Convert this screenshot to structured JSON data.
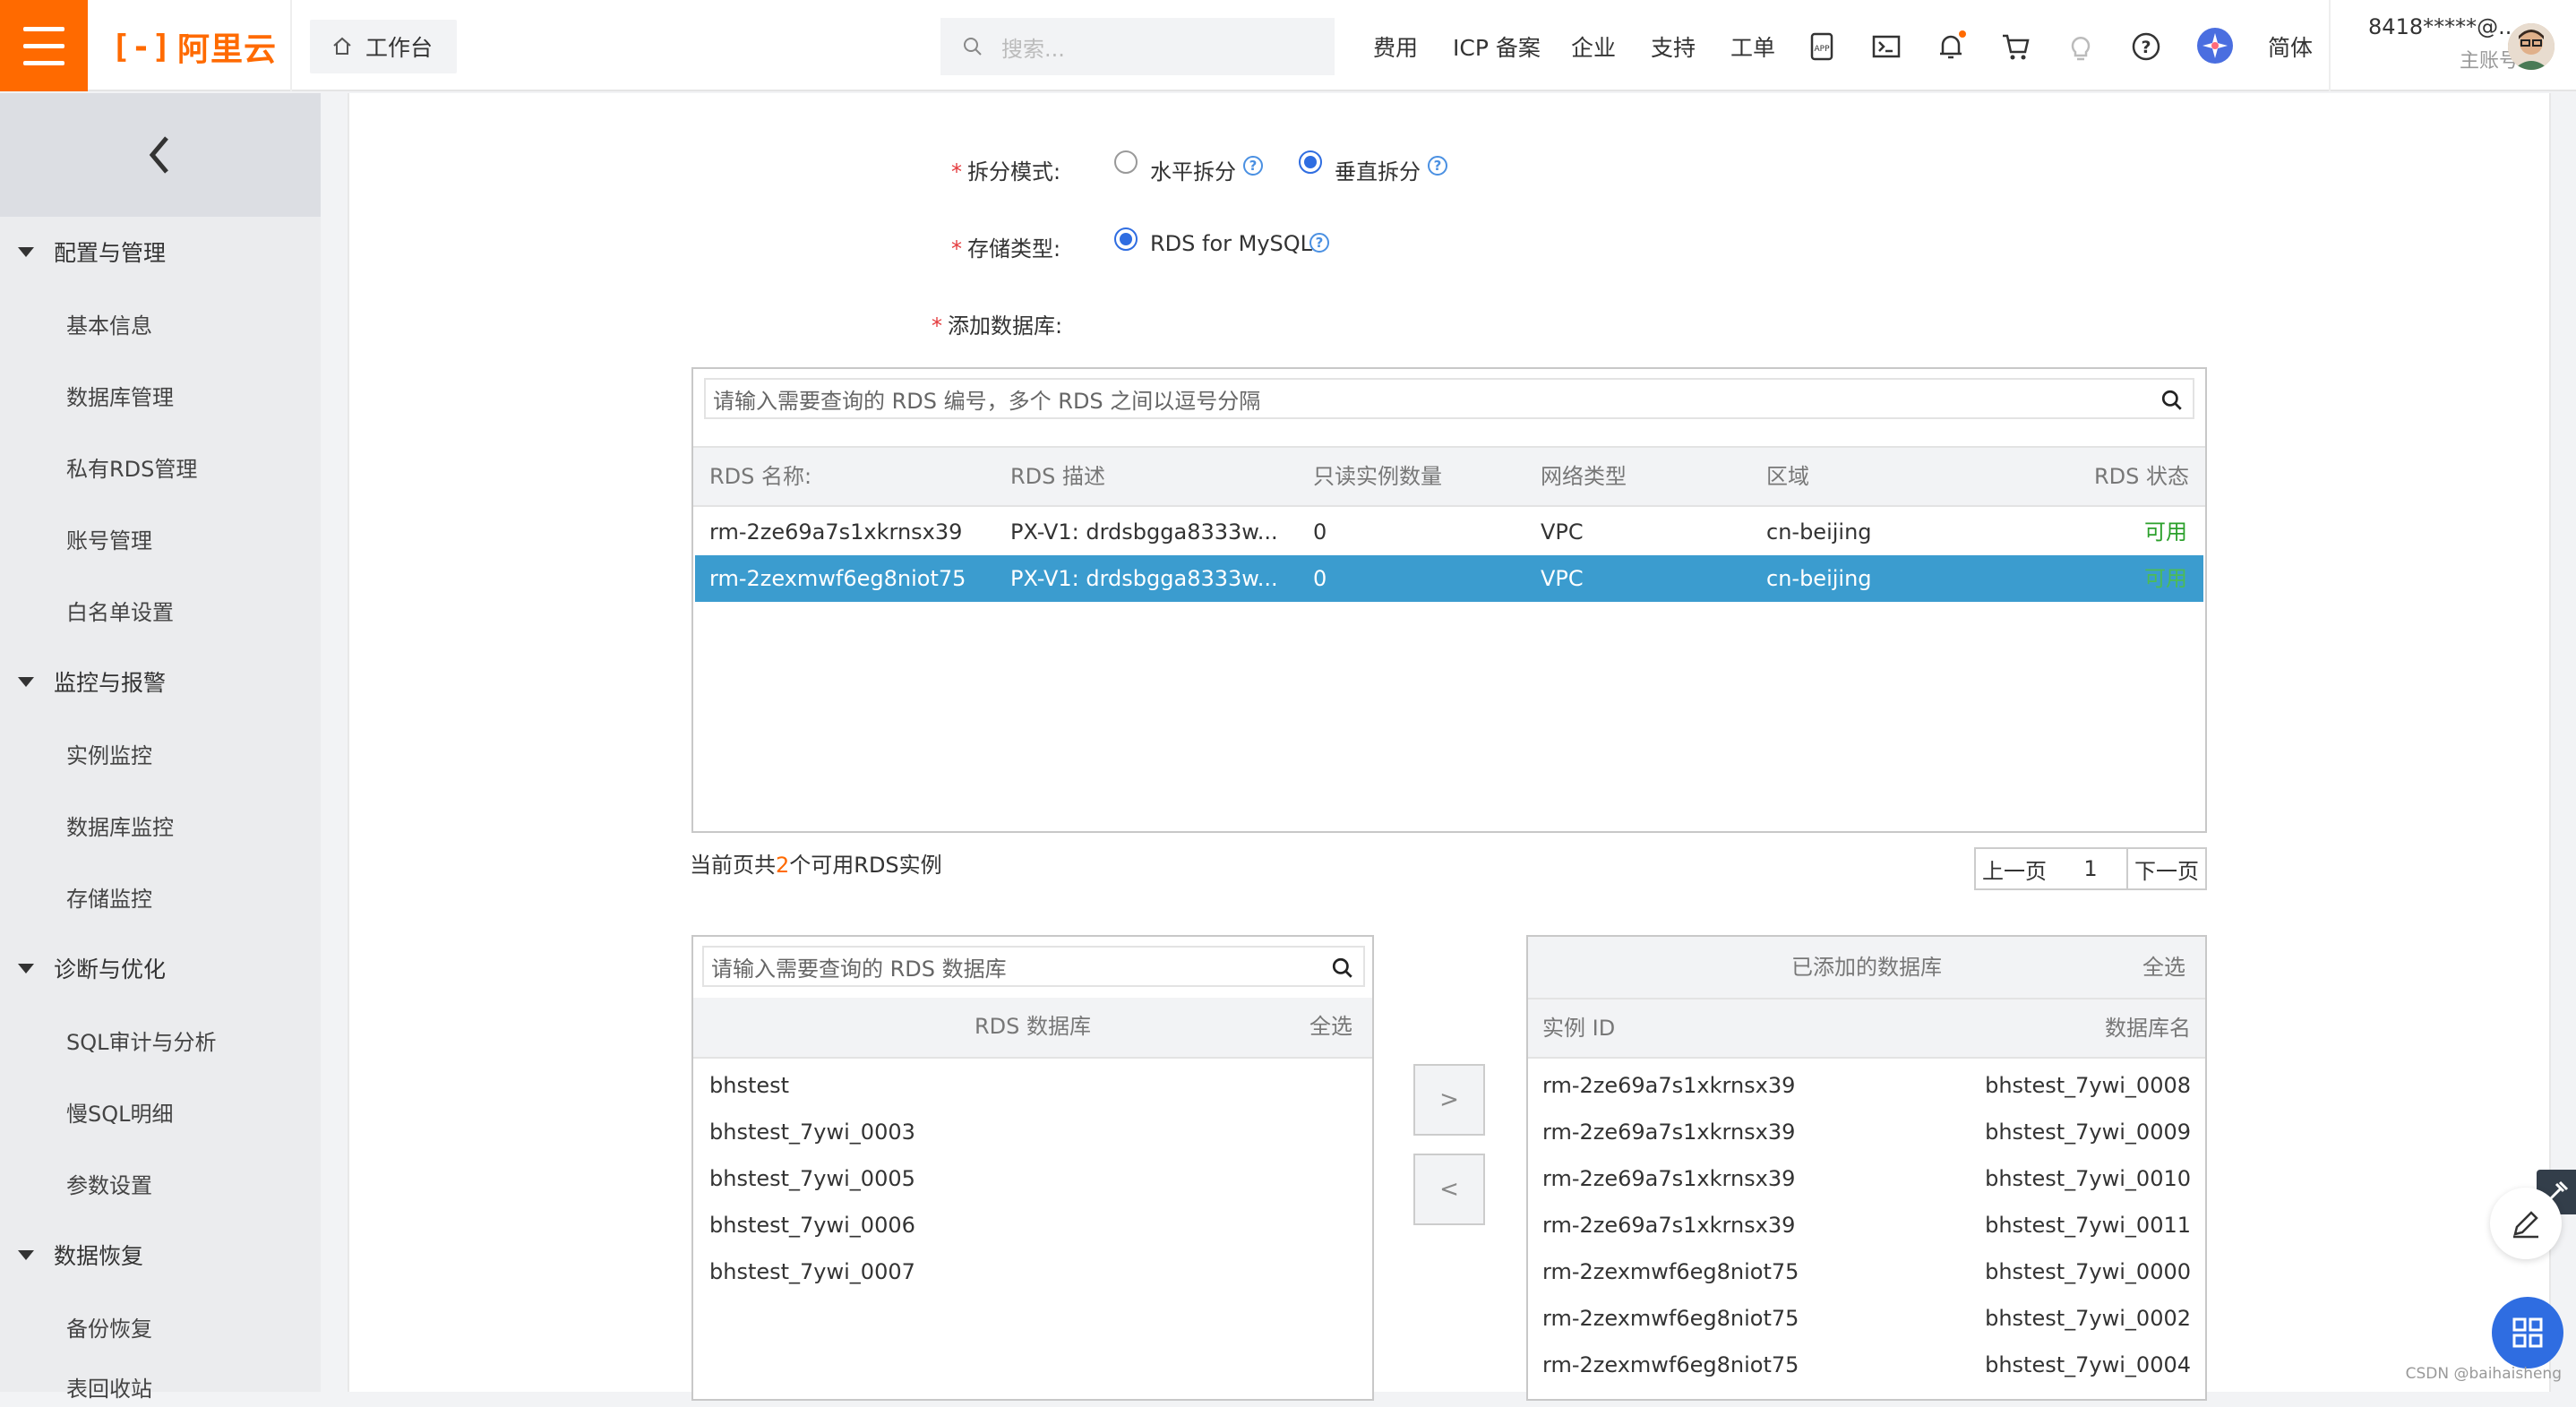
{
  "header": {
    "logo_text": "阿里云",
    "workbench": "工作台",
    "search_placeholder": "搜索...",
    "nav": [
      "费用",
      "ICP 备案",
      "企业",
      "支持",
      "工单"
    ],
    "lang": "简体",
    "account_name": "8418*****@...",
    "account_type": "主账号"
  },
  "sidebar": {
    "groups": [
      {
        "label": "配置与管理",
        "items": [
          "基本信息",
          "数据库管理",
          "私有RDS管理",
          "账号管理",
          "白名单设置"
        ]
      },
      {
        "label": "监控与报警",
        "items": [
          "实例监控",
          "数据库监控",
          "存储监控"
        ]
      },
      {
        "label": "诊断与优化",
        "items": [
          "SQL审计与分析",
          "慢SQL明细",
          "参数设置"
        ]
      },
      {
        "label": "数据恢复",
        "items": [
          "备份恢复",
          "表回收站"
        ]
      }
    ]
  },
  "form": {
    "split_mode_label": "拆分模式:",
    "split_horizontal": "水平拆分",
    "split_vertical": "垂直拆分",
    "split_selected": "垂直拆分",
    "storage_label": "存储类型:",
    "storage_option": "RDS for MySQL",
    "add_db_label": "添加数据库:"
  },
  "rds_table": {
    "search_placeholder": "请输入需要查询的 RDS 编号，多个 RDS 之间以逗号分隔",
    "columns": [
      "RDS 名称:",
      "RDS 描述",
      "只读实例数量",
      "网络类型",
      "区域",
      "RDS 状态"
    ],
    "rows": [
      {
        "name": "rm-2ze69a7s1xkrnsx39",
        "desc": "PX-V1: drdsbgga8333w...",
        "readonly": "0",
        "network": "VPC",
        "region": "cn-beijing",
        "status": "可用",
        "selected": false
      },
      {
        "name": "rm-2zexmwf6eg8niot75",
        "desc": "PX-V1: drdsbgga8333w...",
        "readonly": "0",
        "network": "VPC",
        "region": "cn-beijing",
        "status": "可用",
        "selected": true
      }
    ],
    "count_prefix": "当前页共",
    "count": "2",
    "count_suffix": "个可用RDS实例",
    "prev": "上一页",
    "page": "1",
    "next": "下一页"
  },
  "rds_db_panel": {
    "search_placeholder": "请输入需要查询的 RDS 数据库",
    "title": "RDS 数据库",
    "select_all": "全选",
    "items": [
      "bhstest",
      "bhstest_7ywi_0003",
      "bhstest_7ywi_0005",
      "bhstest_7ywi_0006",
      "bhstest_7ywi_0007"
    ]
  },
  "move": {
    "right": ">",
    "left": "<"
  },
  "added_panel": {
    "title": "已添加的数据库",
    "select_all": "全选",
    "col_instance": "实例 ID",
    "col_db": "数据库名",
    "rows": [
      {
        "instance": "rm-2ze69a7s1xkrnsx39",
        "db": "bhstest_7ywi_0008"
      },
      {
        "instance": "rm-2ze69a7s1xkrnsx39",
        "db": "bhstest_7ywi_0009"
      },
      {
        "instance": "rm-2ze69a7s1xkrnsx39",
        "db": "bhstest_7ywi_0010"
      },
      {
        "instance": "rm-2ze69a7s1xkrnsx39",
        "db": "bhstest_7ywi_0011"
      },
      {
        "instance": "rm-2zexmwf6eg8niot75",
        "db": "bhstest_7ywi_0000"
      },
      {
        "instance": "rm-2zexmwf6eg8niot75",
        "db": "bhstest_7ywi_0002"
      },
      {
        "instance": "rm-2zexmwf6eg8niot75",
        "db": "bhstest_7ywi_0004"
      }
    ]
  },
  "watermark": "CSDN @baihaisheng",
  "colors": {
    "brand": "#ff6a00",
    "selected_row": "#3b9ccf",
    "status_ok": "#2ba02b",
    "link_blue": "#2f6de1"
  }
}
